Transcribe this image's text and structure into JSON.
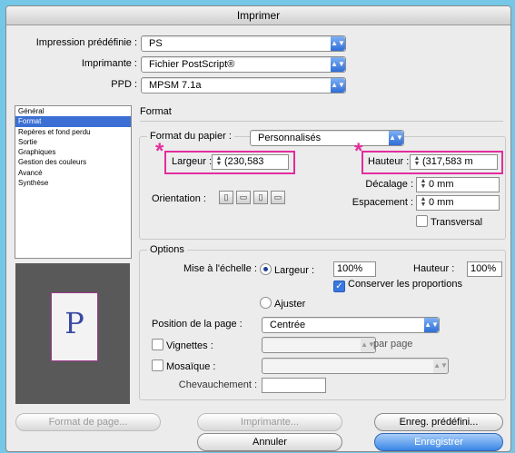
{
  "window": {
    "title": "Imprimer"
  },
  "top": {
    "preset_label": "Impression prédéfinie :",
    "preset_value": "PS",
    "printer_label": "Imprimante :",
    "printer_value": "Fichier PostScript®",
    "ppd_label": "PPD :",
    "ppd_value": "MPSM 7.1a"
  },
  "sidebar": {
    "items": [
      "Général",
      "Format",
      "Repères et fond perdu",
      "Sortie",
      "Graphiques",
      "Gestion des couleurs",
      "Avancé",
      "Synthèse"
    ],
    "selected": "Format"
  },
  "preview": {
    "letter": "P"
  },
  "format": {
    "section_title": "Format",
    "paper_label": "Format du papier :",
    "paper_value": "Personnalisés",
    "width_label": "Largeur :",
    "width_value": "(230,583",
    "height_label": "Hauteur :",
    "height_value": "(317,583 m",
    "orientation_label": "Orientation :",
    "offset_label": "Décalage :",
    "offset_value": "0 mm",
    "gap_label": "Espacement :",
    "gap_value": "0 mm",
    "transverse_label": "Transversal",
    "transverse_checked": false,
    "highlight_color": "#e22d9c"
  },
  "options": {
    "title": "Options",
    "scale_label": "Mise à l'échelle :",
    "scale_width_label": "Largeur :",
    "scale_width_value": "100%",
    "scale_height_label": "Hauteur :",
    "scale_height_value": "100%",
    "keep_proportions_label": "Conserver les proportions",
    "keep_proportions_checked": true,
    "fit_label": "Ajuster",
    "position_label": "Position de la page :",
    "position_value": "Centrée",
    "thumbnails_label": "Vignettes :",
    "per_page_label": "par page",
    "tile_label": "Mosaïque :",
    "overlap_label": "Chevauchement :"
  },
  "buttons": {
    "page_setup": "Format de page...",
    "printer": "Imprimante...",
    "save_preset": "Enreg. prédéfini...",
    "cancel": "Annuler",
    "save": "Enregistrer"
  }
}
